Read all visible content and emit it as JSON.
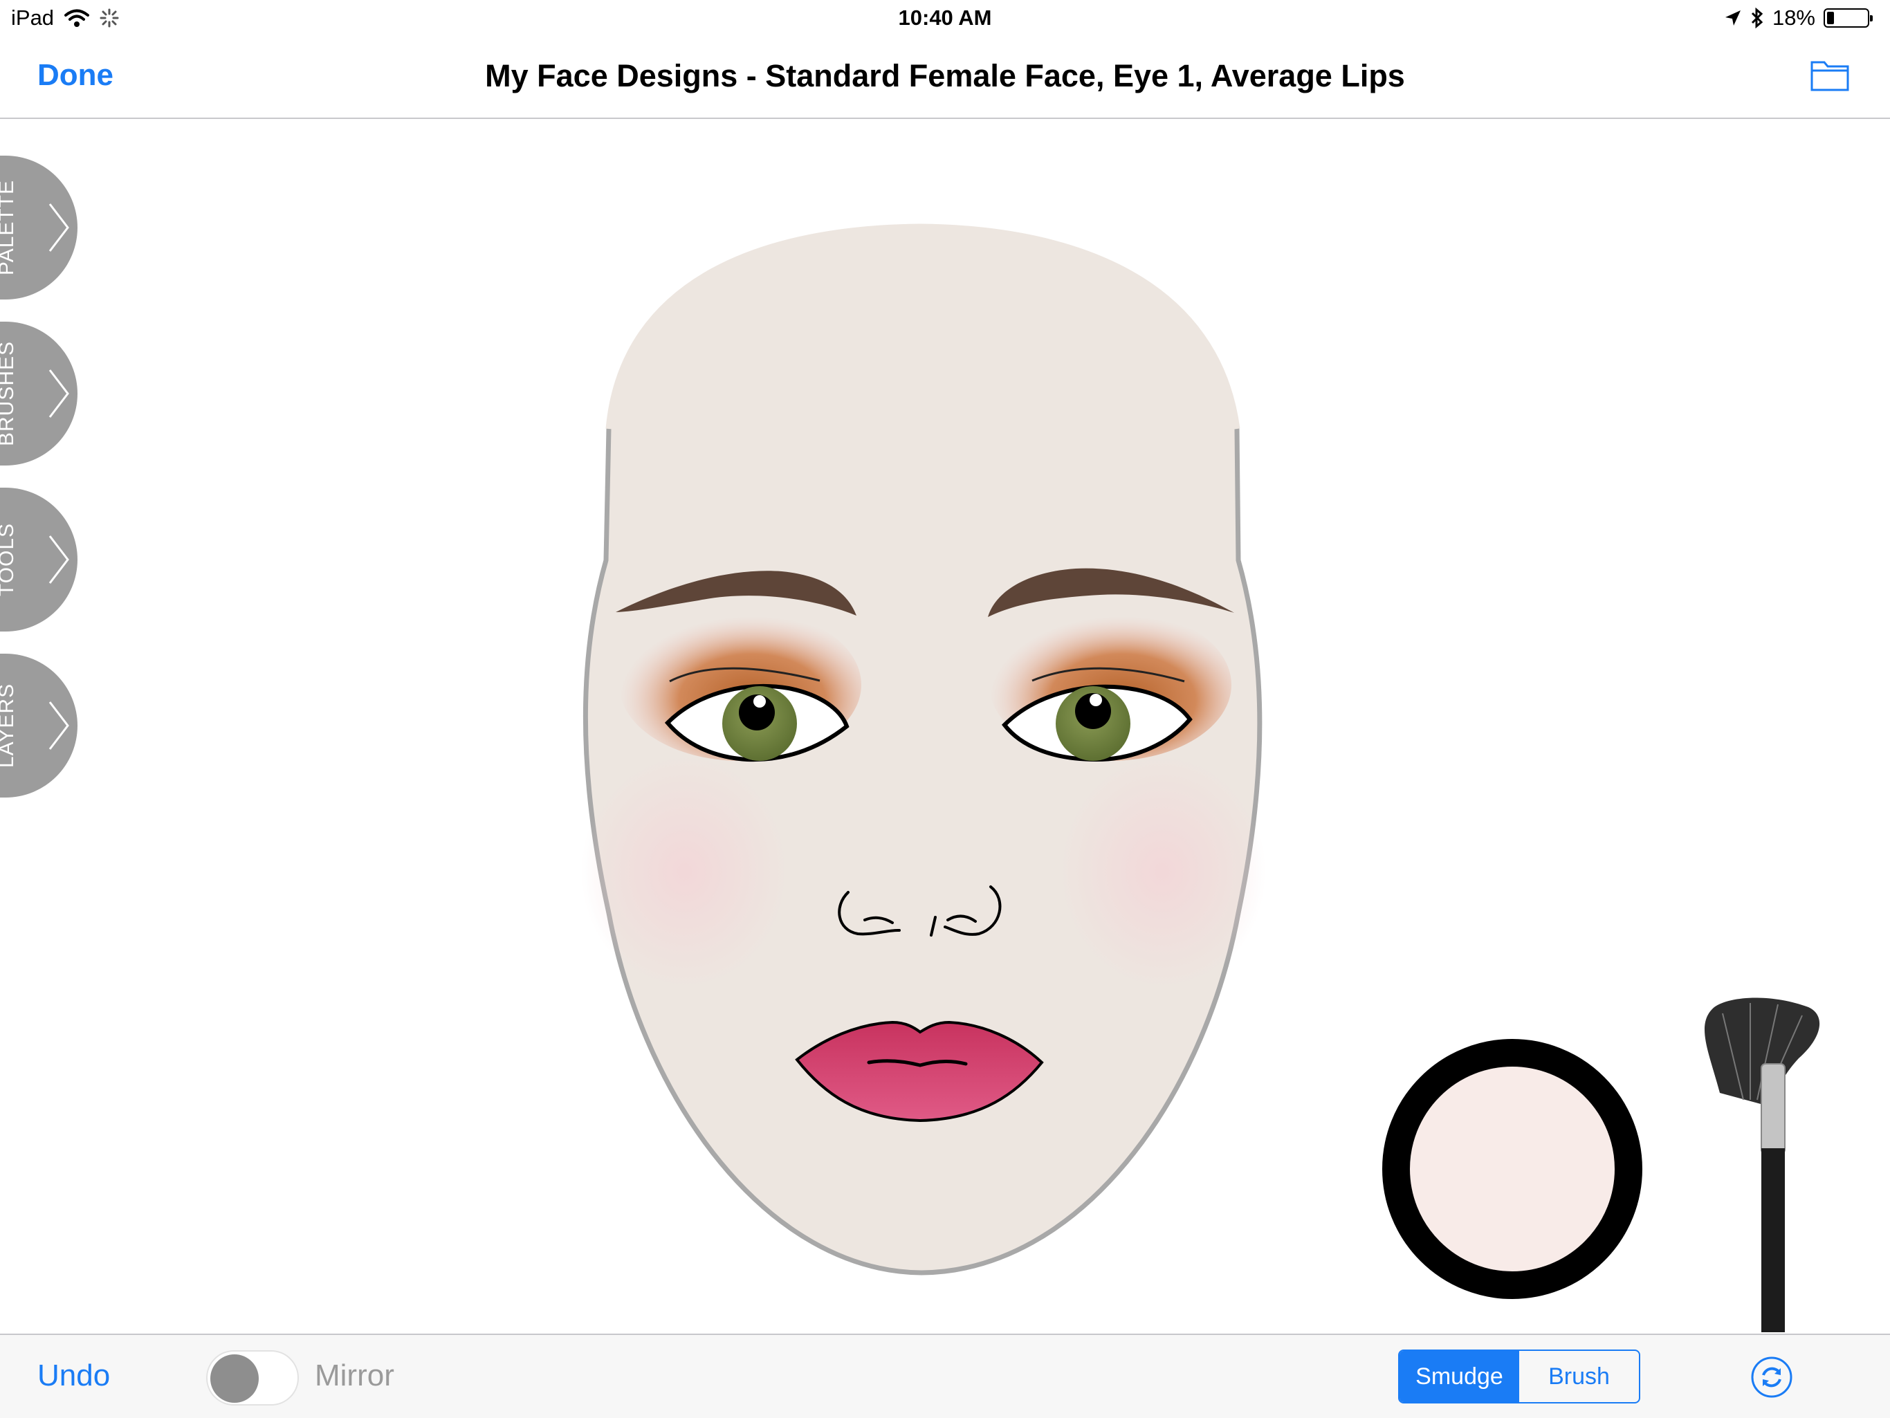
{
  "status_bar": {
    "device": "iPad",
    "time": "10:40 AM",
    "battery_percent": "18%",
    "battery_level": 0.18,
    "icons": [
      "wifi-icon",
      "activity-spinner-icon",
      "location-arrow-icon",
      "bluetooth-icon",
      "battery-icon"
    ]
  },
  "nav": {
    "done_label": "Done",
    "title": "My Face Designs - Standard Female Face, Eye 1, Average Lips",
    "folder_icon": "folder-icon"
  },
  "side_tabs": [
    {
      "label": "PALETTE"
    },
    {
      "label": "BRUSHES"
    },
    {
      "label": "TOOLS"
    },
    {
      "label": "LAYERS"
    }
  ],
  "canvas": {
    "skin_color": "#ede6e0",
    "outline_color": "#a8a8a8",
    "eyebrow_color": "#5e4538",
    "iris_color": "#6b7f3e",
    "lip_color": "#d3406f",
    "eyeshadow_color": "#b5622a",
    "blush_color": "#f3d6d8",
    "selected_swatch_color": "#f8ebe8"
  },
  "toolbar": {
    "undo_label": "Undo",
    "mirror_label": "Mirror",
    "mirror_on": false,
    "mode_options": [
      "Smudge",
      "Brush"
    ],
    "selected_mode": "Smudge",
    "reset_icon": "refresh-icon",
    "accent_color": "#1a7cf5"
  }
}
